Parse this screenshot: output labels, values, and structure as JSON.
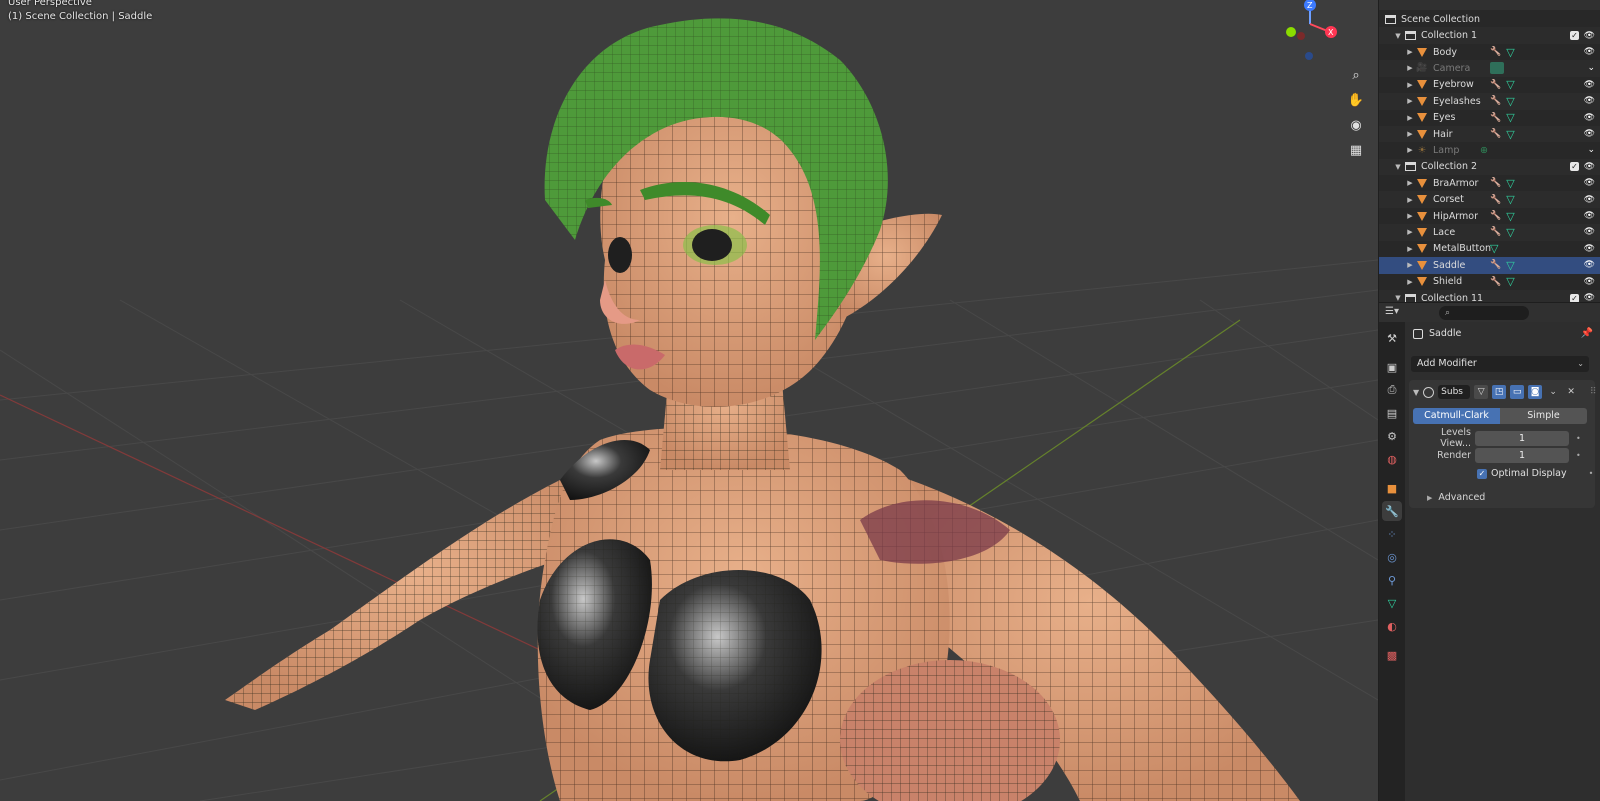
{
  "viewport": {
    "perspective_label": "User Perspective",
    "context_label": "(1) Scene Collection | Saddle",
    "gizmo_axes": {
      "z": "Z",
      "x": "X"
    },
    "nav_icons": [
      "zoom-icon",
      "pan-hand-icon",
      "camera-view-icon",
      "grid-ortho-icon"
    ]
  },
  "outliner": {
    "rows": [
      {
        "label": "Scene Collection",
        "kind": "scene"
      },
      {
        "label": "Collection 1",
        "kind": "collection"
      },
      {
        "label": "Body",
        "kind": "mesh"
      },
      {
        "label": "Camera",
        "kind": "camera",
        "dim": true
      },
      {
        "label": "Eyebrow",
        "kind": "mesh"
      },
      {
        "label": "Eyelashes",
        "kind": "mesh"
      },
      {
        "label": "Eyes",
        "kind": "mesh"
      },
      {
        "label": "Hair",
        "kind": "mesh"
      },
      {
        "label": "Lamp",
        "kind": "light",
        "dim": true
      },
      {
        "label": "Collection 2",
        "kind": "collection"
      },
      {
        "label": "BraArmor",
        "kind": "mesh"
      },
      {
        "label": "Corset",
        "kind": "mesh"
      },
      {
        "label": "HipArmor",
        "kind": "mesh"
      },
      {
        "label": "Lace",
        "kind": "mesh"
      },
      {
        "label": "MetalButton",
        "kind": "mesh"
      },
      {
        "label": "Saddle",
        "kind": "mesh",
        "selected": true
      },
      {
        "label": "Shield",
        "kind": "mesh"
      },
      {
        "label": "Collection 11",
        "kind": "collection"
      }
    ]
  },
  "properties": {
    "object_name": "Saddle",
    "add_modifier": "Add Modifier",
    "modifier": {
      "name": "Subs",
      "algorithms": [
        "Catmull-Clark",
        "Simple"
      ],
      "levels_viewport_label": "Levels View...",
      "levels_viewport": "1",
      "render_label": "Render",
      "render": "1",
      "optimal_display_label": "Optimal Display",
      "advanced_label": "Advanced"
    }
  },
  "colors": {
    "accent": "#4772b3",
    "mesh_icon": "#e8903c",
    "modifier_icon": "#6f9bd9",
    "data_icon": "#30d3a0"
  }
}
